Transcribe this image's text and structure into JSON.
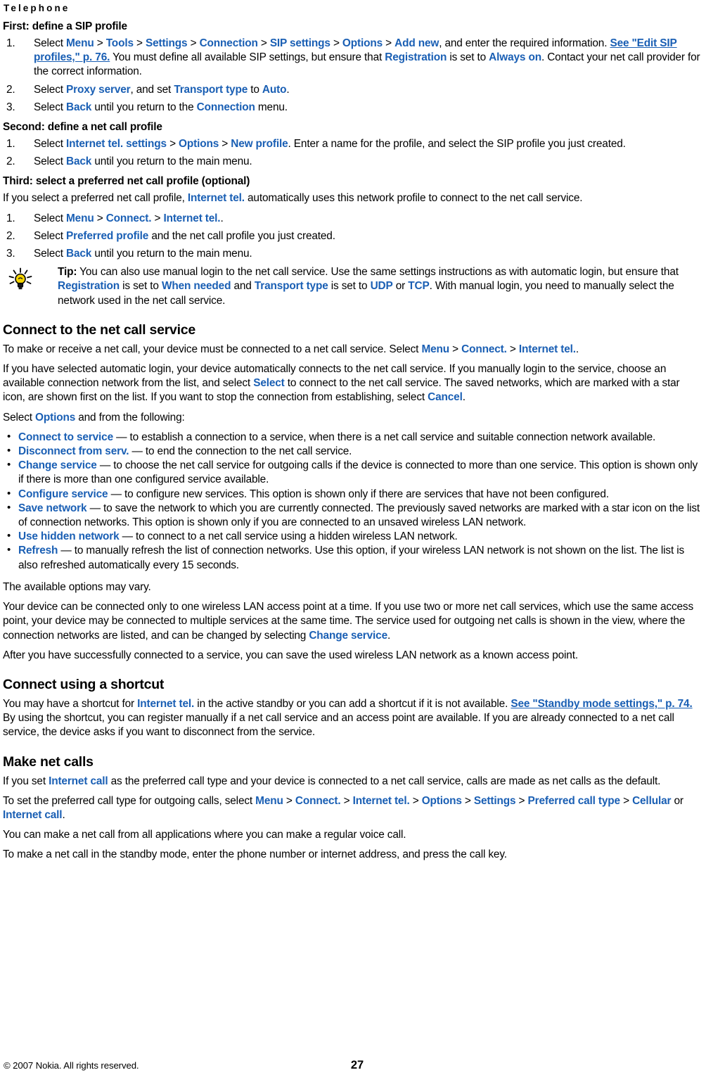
{
  "running_head": "Telephone",
  "sections": {
    "first_sip": {
      "heading": "First: define a SIP profile",
      "steps": [
        {
          "num": "1.",
          "pre": "Select ",
          "path": [
            "Menu",
            "Tools",
            "Settings",
            "Connection",
            "SIP settings",
            "Options",
            "Add new"
          ],
          "mid": ", and enter the required information. ",
          "ref": "See \"Edit SIP profiles,\" p. 76.",
          "tail1": " You must define all available SIP settings, but ensure that ",
          "link1": "Registration",
          "tail2": " is set to ",
          "link2": "Always on",
          "tail3": ". Contact your net call provider for the correct information."
        },
        {
          "num": "2.",
          "pre": "Select ",
          "link1": "Proxy server",
          "tail1": ", and set ",
          "link2": "Transport type",
          "tail2": " to ",
          "link3": "Auto",
          "tail3": "."
        },
        {
          "num": "3.",
          "pre": "Select ",
          "link1": "Back",
          "tail1": " until you return to the ",
          "link2": "Connection",
          "tail2": " menu."
        }
      ]
    },
    "second_netcall": {
      "heading": "Second: define a net call profile",
      "steps": [
        {
          "num": "1.",
          "pre": "Select ",
          "path": [
            "Internet tel. settings",
            "Options",
            "New profile"
          ],
          "tail": ". Enter a name for the profile, and select the SIP profile you just created."
        },
        {
          "num": "2.",
          "pre": "Select ",
          "link1": "Back",
          "tail1": " until you return to the main menu."
        }
      ]
    },
    "third_preferred": {
      "heading": "Third: select a preferred net call profile (optional)",
      "intro_pre": "If you select a preferred net call profile, ",
      "intro_link": "Internet tel.",
      "intro_tail": " automatically uses this network profile to connect to the net call service.",
      "steps": [
        {
          "num": "1.",
          "pre": "Select ",
          "path": [
            "Menu",
            "Connect.",
            "Internet tel."
          ],
          "tail": "."
        },
        {
          "num": "2.",
          "pre": "Select ",
          "link1": "Preferred profile",
          "tail1": " and the net call profile you just created."
        },
        {
          "num": "3.",
          "pre": "Select ",
          "link1": "Back",
          "tail1": " until you return to the main menu."
        }
      ],
      "tip": {
        "icon": "lightbulb-icon",
        "label": "Tip:",
        "text_1": " You can also use manual login to the net call service. Use the same settings instructions as with automatic login, but ensure that ",
        "link_1": "Registration",
        "text_2": " is set to ",
        "link_2": "When needed",
        "text_3": " and ",
        "link_3": "Transport type",
        "text_4": " is set to ",
        "link_4": "UDP",
        "text_5": " or ",
        "link_5": "TCP",
        "text_6": ". With manual login, you need to manually select the network used in the net call service."
      }
    },
    "connect_service": {
      "heading": "Connect to the net call service",
      "p1_pre": "To make or receive a net call, your device must be connected to a net call service. Select ",
      "p1_path": [
        "Menu",
        "Connect.",
        "Internet tel."
      ],
      "p1_tail": ".",
      "p2_a": "If you have selected automatic login, your device automatically connects to the net call service. If you manually login to the service, choose an available connection network from the list, and select ",
      "p2_link1": "Select",
      "p2_b": " to connect to the net call service. The saved networks, which are marked with a star icon, are shown first on the list. If you want to stop the connection from establishing, select ",
      "p2_link2": "Cancel",
      "p2_c": ".",
      "p3_pre": "Select ",
      "p3_link": "Options",
      "p3_tail": " and from the following:",
      "options": [
        {
          "term": "Connect to service",
          "sep": "  — ",
          "desc": "to establish a connection to a service, when there is a net call service and suitable connection network available."
        },
        {
          "term": "Disconnect from serv.",
          "sep": " — ",
          "desc": "to end the connection to the net call service."
        },
        {
          "term": "Change service",
          "sep": " — ",
          "desc": "to choose the net call service for outgoing calls if the device is connected to more than one service. This option is shown only if there is more than one configured service available."
        },
        {
          "term": "Configure service",
          "sep": " — ",
          "desc": "to configure new services. This option is shown only if there are services that have not been configured."
        },
        {
          "term": "Save network",
          "sep": " — ",
          "desc": "to save the network to which you are currently connected. The previously saved networks are marked with a star icon on the list of connection networks. This option is shown only if you are connected to an unsaved wireless LAN network."
        },
        {
          "term": "Use hidden network",
          "sep": " — ",
          "desc": "to connect to a net call service using a hidden wireless LAN network."
        },
        {
          "term": "Refresh",
          "sep": " — ",
          "desc": "to manually refresh the list of connection networks. Use this option, if your wireless LAN network is not shown on the list. The list is also refreshed automatically every 15 seconds."
        }
      ],
      "p4": "The available options may vary.",
      "p5_a": "Your device can be connected only to one wireless LAN access point at a time. If you use two or more net call services, which use the same access point, your device may be connected to multiple services at the same time. The service used for outgoing net calls is shown in the view, where the connection networks are listed, and can be changed by selecting ",
      "p5_link": "Change service",
      "p5_b": ".",
      "p6": "After you have successfully connected to a service, you can save the used wireless LAN network as a known access point."
    },
    "connect_shortcut": {
      "heading": "Connect using a shortcut",
      "p1_a": "You may have a shortcut for ",
      "p1_link": "Internet tel.",
      "p1_b": " in the active standby or you can add a shortcut if it is not available. ",
      "p1_ref": "See \"Standby mode settings,\" p. 74.",
      "p1_c": " By using the shortcut, you can register manually if a net call service and an access point are available. If you are already connected to a net call service, the device asks if you want to disconnect from the service."
    },
    "make_net_calls": {
      "heading": "Make net calls",
      "p1_a": "If you set ",
      "p1_link": "Internet call",
      "p1_b": " as the preferred call type and your device is connected to a net call service, calls are made as net calls as the default.",
      "p2_a": "To set the preferred call type for outgoing calls, select ",
      "p2_path": [
        "Menu",
        "Connect.",
        "Internet tel.",
        "Options",
        "Settings",
        "Preferred call type",
        "Cellular"
      ],
      "p2_or": " or ",
      "p2_last": "Internet call",
      "p2_end": ".",
      "p3": "You can make a net call from all applications where you can make a regular voice call.",
      "p4": "To make a net call in the standby mode, enter the phone number or internet address, and press the call key."
    }
  },
  "footer": {
    "copyright": "© 2007 Nokia. All rights reserved.",
    "page_number": "27"
  },
  "colors": {
    "link": "#1a5fb4",
    "text": "#000000",
    "background": "#ffffff",
    "bulb_yellow": "#f5d400"
  }
}
